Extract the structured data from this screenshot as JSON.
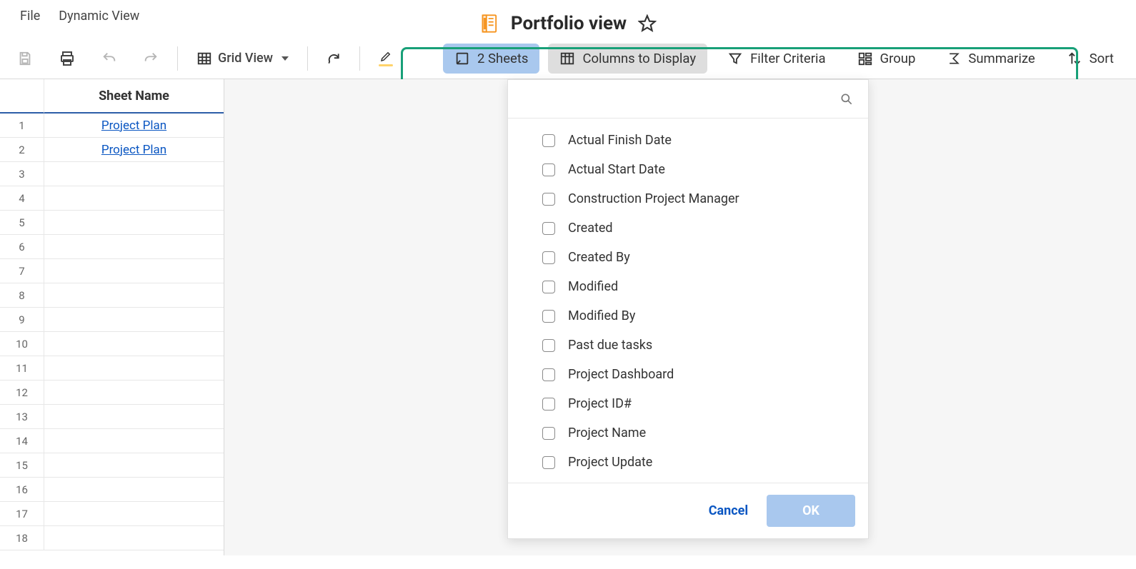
{
  "menu": {
    "file": "File",
    "dynamic_view": "Dynamic View"
  },
  "title": "Portfolio view",
  "toolbar": {
    "grid_view": "Grid View"
  },
  "view_bar": {
    "sheets": "2 Sheets",
    "columns": "Columns to Display",
    "filter": "Filter Criteria",
    "group": "Group",
    "summarize": "Summarize",
    "sort": "Sort"
  },
  "grid": {
    "header": "Sheet Name",
    "rows": [
      {
        "n": "1",
        "link": "Project Plan"
      },
      {
        "n": "2",
        "link": "Project Plan"
      },
      {
        "n": "3",
        "link": ""
      },
      {
        "n": "4",
        "link": ""
      },
      {
        "n": "5",
        "link": ""
      },
      {
        "n": "6",
        "link": ""
      },
      {
        "n": "7",
        "link": ""
      },
      {
        "n": "8",
        "link": ""
      },
      {
        "n": "9",
        "link": ""
      },
      {
        "n": "10",
        "link": ""
      },
      {
        "n": "11",
        "link": ""
      },
      {
        "n": "12",
        "link": ""
      },
      {
        "n": "13",
        "link": ""
      },
      {
        "n": "14",
        "link": ""
      },
      {
        "n": "15",
        "link": ""
      },
      {
        "n": "16",
        "link": ""
      },
      {
        "n": "17",
        "link": ""
      },
      {
        "n": "18",
        "link": ""
      }
    ]
  },
  "panel": {
    "options": [
      "Actual Finish Date",
      "Actual Start Date",
      "Construction Project Manager",
      "Created",
      "Created By",
      "Modified",
      "Modified By",
      "Past due tasks",
      "Project Dashboard",
      "Project ID#",
      "Project Name",
      "Project Update"
    ],
    "cancel": "Cancel",
    "ok": "OK"
  }
}
